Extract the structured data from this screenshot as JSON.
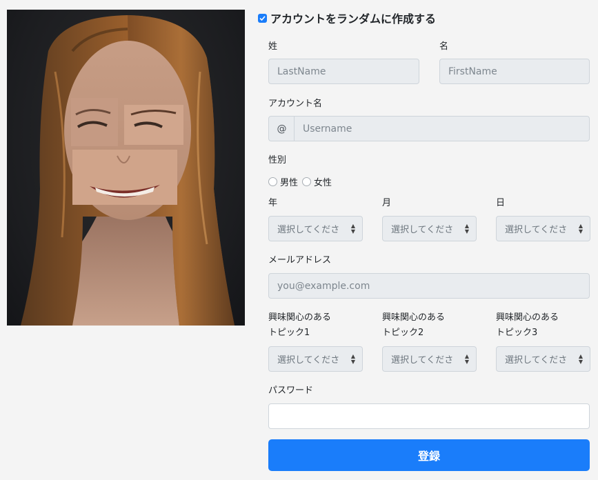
{
  "random_account": {
    "label": "アカウントをランダムに作成する",
    "checked": true
  },
  "last_name": {
    "label": "姓",
    "placeholder": "LastName"
  },
  "first_name": {
    "label": "名",
    "placeholder": "FirstName"
  },
  "account_name": {
    "label": "アカウント名",
    "prefix": "@",
    "placeholder": "Username"
  },
  "gender": {
    "label": "性別",
    "options": [
      "男性",
      "女性"
    ]
  },
  "birth": {
    "year": {
      "label": "年",
      "value": "選択してくださ"
    },
    "month": {
      "label": "月",
      "value": "選択してくださ"
    },
    "day": {
      "label": "日",
      "value": "選択してくださ"
    }
  },
  "email": {
    "label": "メールアドレス",
    "placeholder": "you@example.com"
  },
  "topics": [
    {
      "label_line1": "興味関心のある",
      "label_line2": "トピック1",
      "value": "選択してくださ"
    },
    {
      "label_line1": "興味関心のある",
      "label_line2": "トピック2",
      "value": "選択してくださ"
    },
    {
      "label_line1": "興味関心のある",
      "label_line2": "トピック3",
      "value": "選択してくださ"
    }
  ],
  "password": {
    "label": "パスワード",
    "value": ""
  },
  "submit": {
    "label": "登録"
  },
  "colors": {
    "primary": "#1a7dfa",
    "field_bg": "#e9ecef",
    "page_bg": "#f4f4f4"
  }
}
